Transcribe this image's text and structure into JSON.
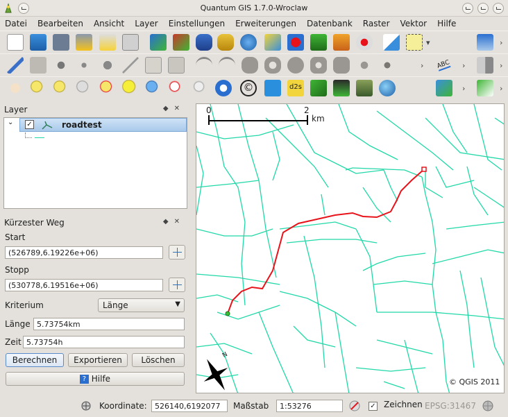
{
  "window": {
    "title": "Quantum GIS 1.7.0-Wroclaw"
  },
  "menu": [
    "Datei",
    "Bearbeiten",
    "Ansicht",
    "Layer",
    "Einstellungen",
    "Erweiterungen",
    "Datenbank",
    "Raster",
    "Vektor",
    "Hilfe"
  ],
  "toolbar": {
    "chevron": "›",
    "label_d2s": "d2s",
    "label_abc": "ABC",
    "label_copyright": "©"
  },
  "layers_panel": {
    "title": "Layer",
    "controls": "◆✕",
    "layer_name": "roadtest",
    "layer_checked": true
  },
  "route_panel": {
    "title": "Kürzester Weg",
    "controls": "◆✕",
    "start_label": "Start",
    "start_value": "(526789,6.19226e+06)",
    "stop_label": "Stopp",
    "stop_value": "(530778,6.19516e+06)",
    "criterion_label": "Kriterium",
    "criterion_value": "Länge",
    "length_label": "Länge",
    "length_value": "5.73754km",
    "time_label": "Zeit",
    "time_value": "5.73754h",
    "btn_calc": "Berechnen",
    "btn_export": "Exportieren",
    "btn_clear": "Löschen",
    "btn_help": "Hilfe"
  },
  "map": {
    "scale_start": "0",
    "scale_end": "2",
    "scale_unit": "km",
    "north_label": "N",
    "copyright": "© QGIS 2011",
    "road_color": "#20d8a8",
    "route_color": "#e8121a",
    "start_marker_color": "#36c036",
    "end_marker_color": "#e8121a"
  },
  "statusbar": {
    "coord_label": "Koordinate:",
    "coord_value": "526140,6192077",
    "scale_label": "Maßstab",
    "scale_value": "1:53276",
    "render_label": "Zeichnen",
    "render_checked": true,
    "crs": "EPSG:31467"
  }
}
